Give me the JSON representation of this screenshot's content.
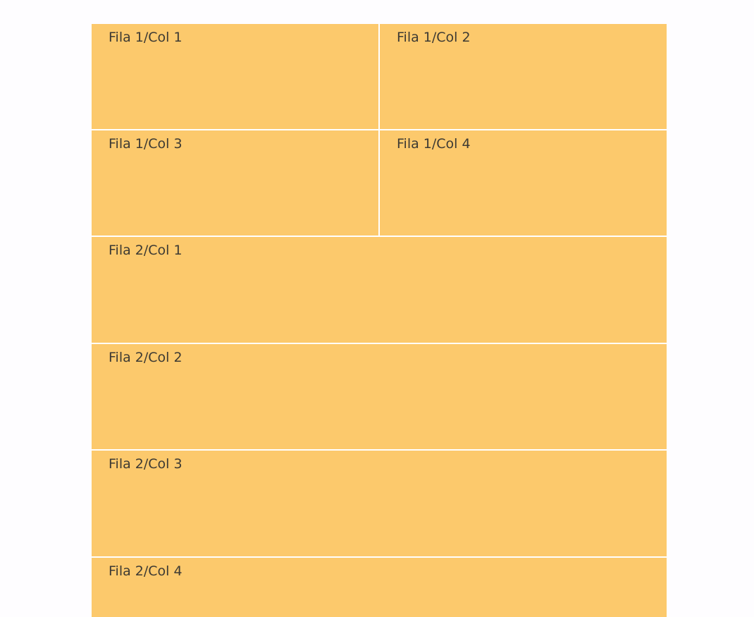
{
  "grid": {
    "cells": [
      {
        "label": "Fila 1/Col 1"
      },
      {
        "label": "Fila 1/Col 2"
      },
      {
        "label": "Fila 1/Col 3"
      },
      {
        "label": "Fila 1/Col 4"
      },
      {
        "label": "Fila 2/Col 1"
      },
      {
        "label": "Fila 2/Col 2"
      },
      {
        "label": "Fila 2/Col 3"
      },
      {
        "label": "Fila 2/Col 4"
      }
    ]
  },
  "colors": {
    "cell_background": "#fcc96c",
    "text": "#3d3a33",
    "page_background": "#fefdff"
  }
}
